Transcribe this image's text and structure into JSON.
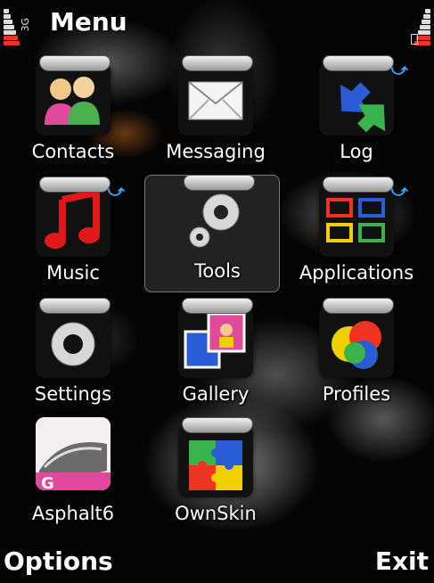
{
  "header": {
    "title": "Menu",
    "network_label": "3G",
    "signal_bars": 7,
    "battery_bars": 7
  },
  "grid": {
    "items": [
      {
        "label": "Contacts",
        "icon": "contacts-icon",
        "arrow": false
      },
      {
        "label": "Messaging",
        "icon": "envelope-icon",
        "arrow": false
      },
      {
        "label": "Log",
        "icon": "log-arrows-icon",
        "arrow": true
      },
      {
        "label": "Music",
        "icon": "music-note-icon",
        "arrow": true
      },
      {
        "label": "Tools",
        "icon": "gears-icon",
        "arrow": false,
        "selected": true
      },
      {
        "label": "Applications",
        "icon": "applications-grid-icon",
        "arrow": true
      },
      {
        "label": "Settings",
        "icon": "gear-icon",
        "arrow": false
      },
      {
        "label": "Gallery",
        "icon": "gallery-icon",
        "arrow": false
      },
      {
        "label": "Profiles",
        "icon": "profiles-icon",
        "arrow": false
      },
      {
        "label": "Asphalt6",
        "icon": "asphalt6-icon",
        "arrow": false
      },
      {
        "label": "OwnSkin",
        "icon": "puzzle-icon",
        "arrow": false
      }
    ]
  },
  "softkeys": {
    "left": "Options",
    "right": "Exit"
  },
  "colors": {
    "accent": "#33aaff",
    "label": "#ffffff",
    "signal_low": "#e33322"
  }
}
